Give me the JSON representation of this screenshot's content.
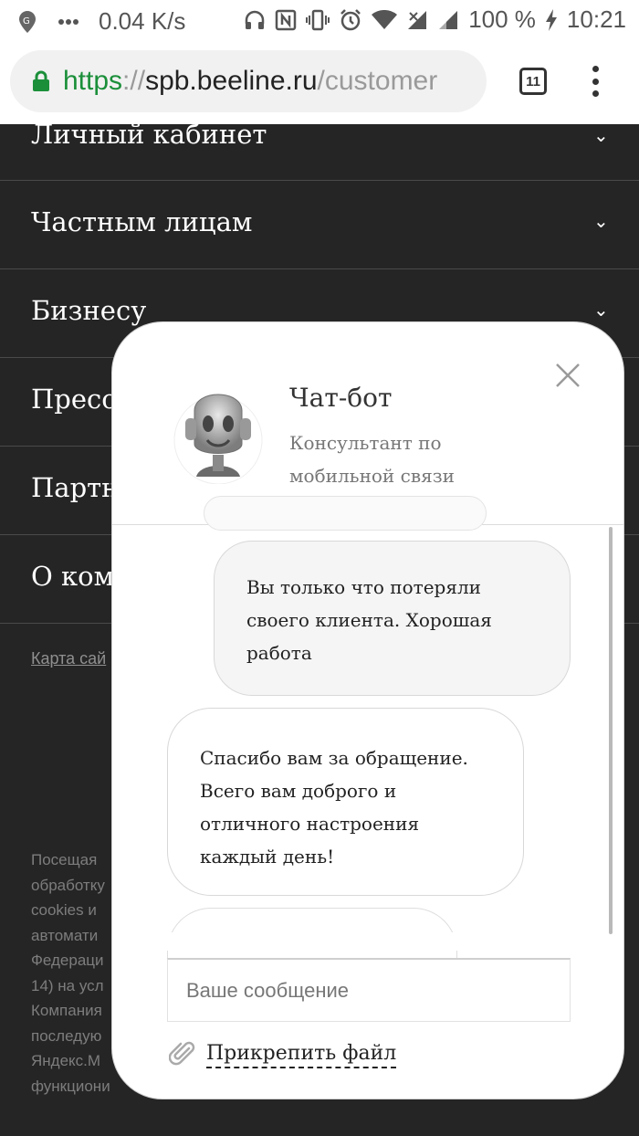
{
  "status_bar": {
    "speed": "0.04 K/s",
    "battery": "100 %",
    "time": "10:21"
  },
  "browser": {
    "url_scheme": "https",
    "url_separator": "://",
    "url_host": "spb.beeline.ru",
    "url_path": "/customer",
    "tab_count": "11",
    "secure_color": "#1b8f3a"
  },
  "nav": {
    "items": [
      "Личный кабинет",
      "Частным лицам",
      "Бизнесу",
      "Пресс",
      "Партн",
      "О ком"
    ],
    "sitemap": "Карта сай"
  },
  "fine_print": [
    "Посещая",
    "обработку",
    "cookies и",
    "автомати",
    "Федераци",
    "14) на усл",
    "Компания",
    "последую",
    "Яндекс.М",
    "функциони"
  ],
  "chat": {
    "bot_name": "Чат-бот",
    "bot_description": "Консультант по мобильной связи",
    "messages": [
      {
        "from": "user",
        "lines": [
          "Вы только что потеряли",
          "своего клиента. Хорошая",
          "работа"
        ]
      },
      {
        "from": "bot",
        "lines": [
          "Спасибо вам за обращение.",
          "Всего вам доброго и",
          "отличного настроения",
          "каждый день!"
        ]
      }
    ],
    "input_placeholder": "Ваше сообщение",
    "attach_label": "Прикрепить файл"
  }
}
